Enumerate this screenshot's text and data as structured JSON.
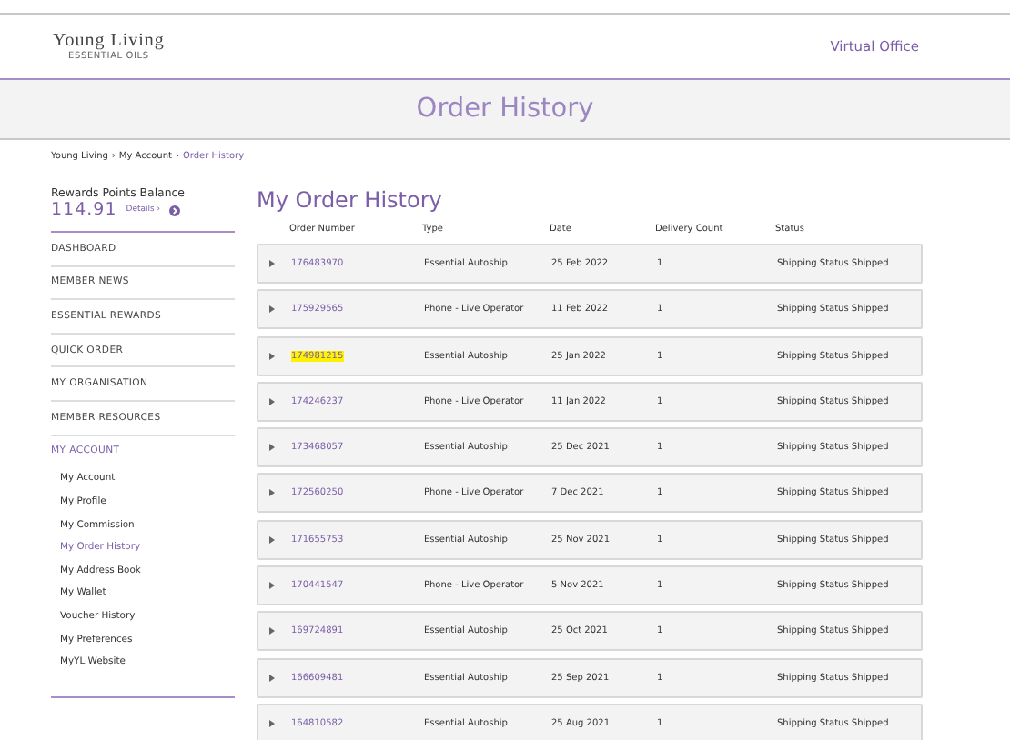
{
  "header": {
    "logo": {
      "name": "Young Living",
      "tagline": "ESSENTIAL OILS"
    },
    "link": "Virtual Office"
  },
  "banner": {
    "title": "Order History"
  },
  "breadcrumb_separator": "›",
  "breadcrumb": [
    {
      "label": "Young Living",
      "current": false
    },
    {
      "label": "My Account",
      "current": false
    },
    {
      "label": "Order History",
      "current": true
    }
  ],
  "sidebar": {
    "rewards_label": "Rewards Points Balance",
    "rewards_value": "114.91",
    "details_link": "Details ›",
    "items": [
      {
        "label": "DASHBOARD",
        "selected": false
      },
      {
        "label": "MEMBER NEWS",
        "selected": false
      },
      {
        "label": "ESSENTIAL REWARDS",
        "selected": false
      },
      {
        "label": "QUICK ORDER",
        "selected": false
      },
      {
        "label": "MY ORGANISATION",
        "selected": false
      },
      {
        "label": "MEMBER RESOURCES",
        "selected": false
      },
      {
        "label": "MY ACCOUNT",
        "selected": true,
        "children": [
          {
            "label": "My Account",
            "selected": false
          },
          {
            "label": "My Profile",
            "selected": false
          },
          {
            "label": "My Commission",
            "selected": false
          },
          {
            "label": "My Order History",
            "selected": true
          },
          {
            "label": "My Address Book",
            "selected": false
          },
          {
            "label": "My Wallet",
            "selected": false
          },
          {
            "label": "Voucher History",
            "selected": false
          },
          {
            "label": "My Preferences",
            "selected": false
          },
          {
            "label": "MyYL Website",
            "selected": false
          }
        ]
      }
    ]
  },
  "main": {
    "title": "My Order History",
    "columns": [
      "Order Number",
      "Type",
      "Date",
      "Delivery Count",
      "Status"
    ],
    "rows": [
      {
        "order": "176483970",
        "type": "Essential Autoship",
        "date": "25 Feb 2022",
        "count": "1",
        "status": "Shipping Status Shipped",
        "highlighted": false
      },
      {
        "order": "175929565",
        "type": "Phone - Live Operator",
        "date": "11 Feb 2022",
        "count": "1",
        "status": "Shipping Status Shipped",
        "highlighted": false
      },
      {
        "order": "174981215",
        "type": "Essential Autoship",
        "date": "25 Jan 2022",
        "count": "1",
        "status": "Shipping Status Shipped",
        "highlighted": true
      },
      {
        "order": "174246237",
        "type": "Phone - Live Operator",
        "date": "11 Jan 2022",
        "count": "1",
        "status": "Shipping Status Shipped",
        "highlighted": false
      },
      {
        "order": "173468057",
        "type": "Essential Autoship",
        "date": "25 Dec 2021",
        "count": "1",
        "status": "Shipping Status Shipped",
        "highlighted": false
      },
      {
        "order": "172560250",
        "type": "Phone - Live Operator",
        "date": "7 Dec 2021",
        "count": "1",
        "status": "Shipping Status Shipped",
        "highlighted": false
      },
      {
        "order": "171655753",
        "type": "Essential Autoship",
        "date": "25 Nov 2021",
        "count": "1",
        "status": "Shipping Status Shipped",
        "highlighted": false
      },
      {
        "order": "170441547",
        "type": "Phone - Live Operator",
        "date": "5 Nov 2021",
        "count": "1",
        "status": "Shipping Status Shipped",
        "highlighted": false
      },
      {
        "order": "169724891",
        "type": "Essential Autoship",
        "date": "25 Oct 2021",
        "count": "1",
        "status": "Shipping Status Shipped",
        "highlighted": false
      },
      {
        "order": "166609481",
        "type": "Essential Autoship",
        "date": "25 Sep 2021",
        "count": "1",
        "status": "Shipping Status Shipped",
        "highlighted": false
      },
      {
        "order": "164810582",
        "type": "Essential Autoship",
        "date": "25 Aug 2021",
        "count": "1",
        "status": "Shipping Status Shipped",
        "highlighted": false
      }
    ]
  }
}
